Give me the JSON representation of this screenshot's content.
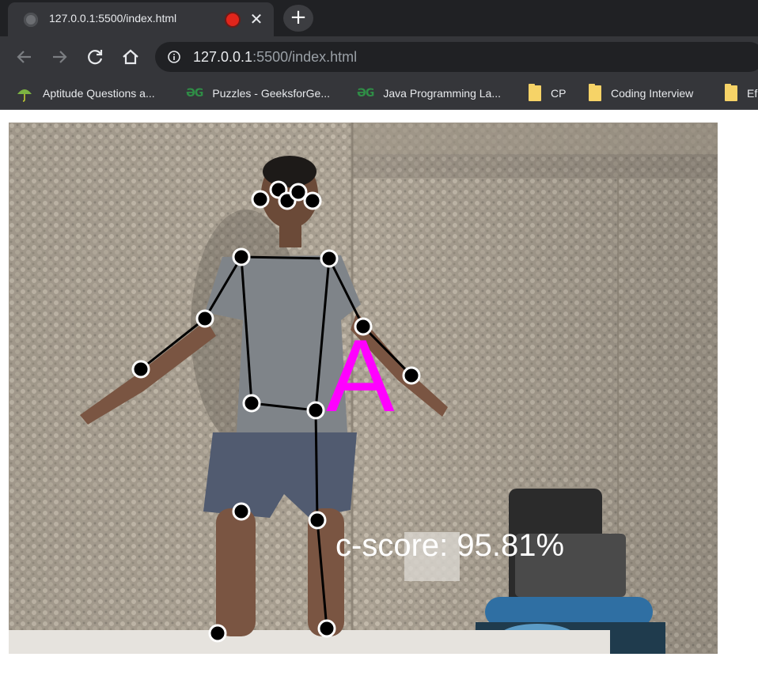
{
  "tab": {
    "title": "127.0.0.1:5500/index.html",
    "close_label": "✕",
    "new_tab_label": "+"
  },
  "toolbar": {
    "url_host": "127.0.0.1",
    "url_rest": ":5500/index.html"
  },
  "bookmarks": [
    {
      "label": "Aptitude Questions a...",
      "icon": "umbrella-icon"
    },
    {
      "label": "Puzzles - GeeksforGe...",
      "icon": "geeksforgeeks-icon"
    },
    {
      "label": "Java Programming La...",
      "icon": "geeksforgeeks-icon"
    },
    {
      "label": "CP",
      "icon": "folder-icon"
    },
    {
      "label": "Coding Interview",
      "icon": "folder-icon"
    },
    {
      "label": "Ef",
      "icon": "folder-icon"
    }
  ],
  "gg_glyph": "ƏG",
  "pose": {
    "letter": "A",
    "cscore": "c-score: 95.81%"
  },
  "colors": {
    "letter": "#ff00ff",
    "skeleton": "#000000",
    "keypoint_fill": "#000000",
    "keypoint_stroke": "#ffffff"
  }
}
